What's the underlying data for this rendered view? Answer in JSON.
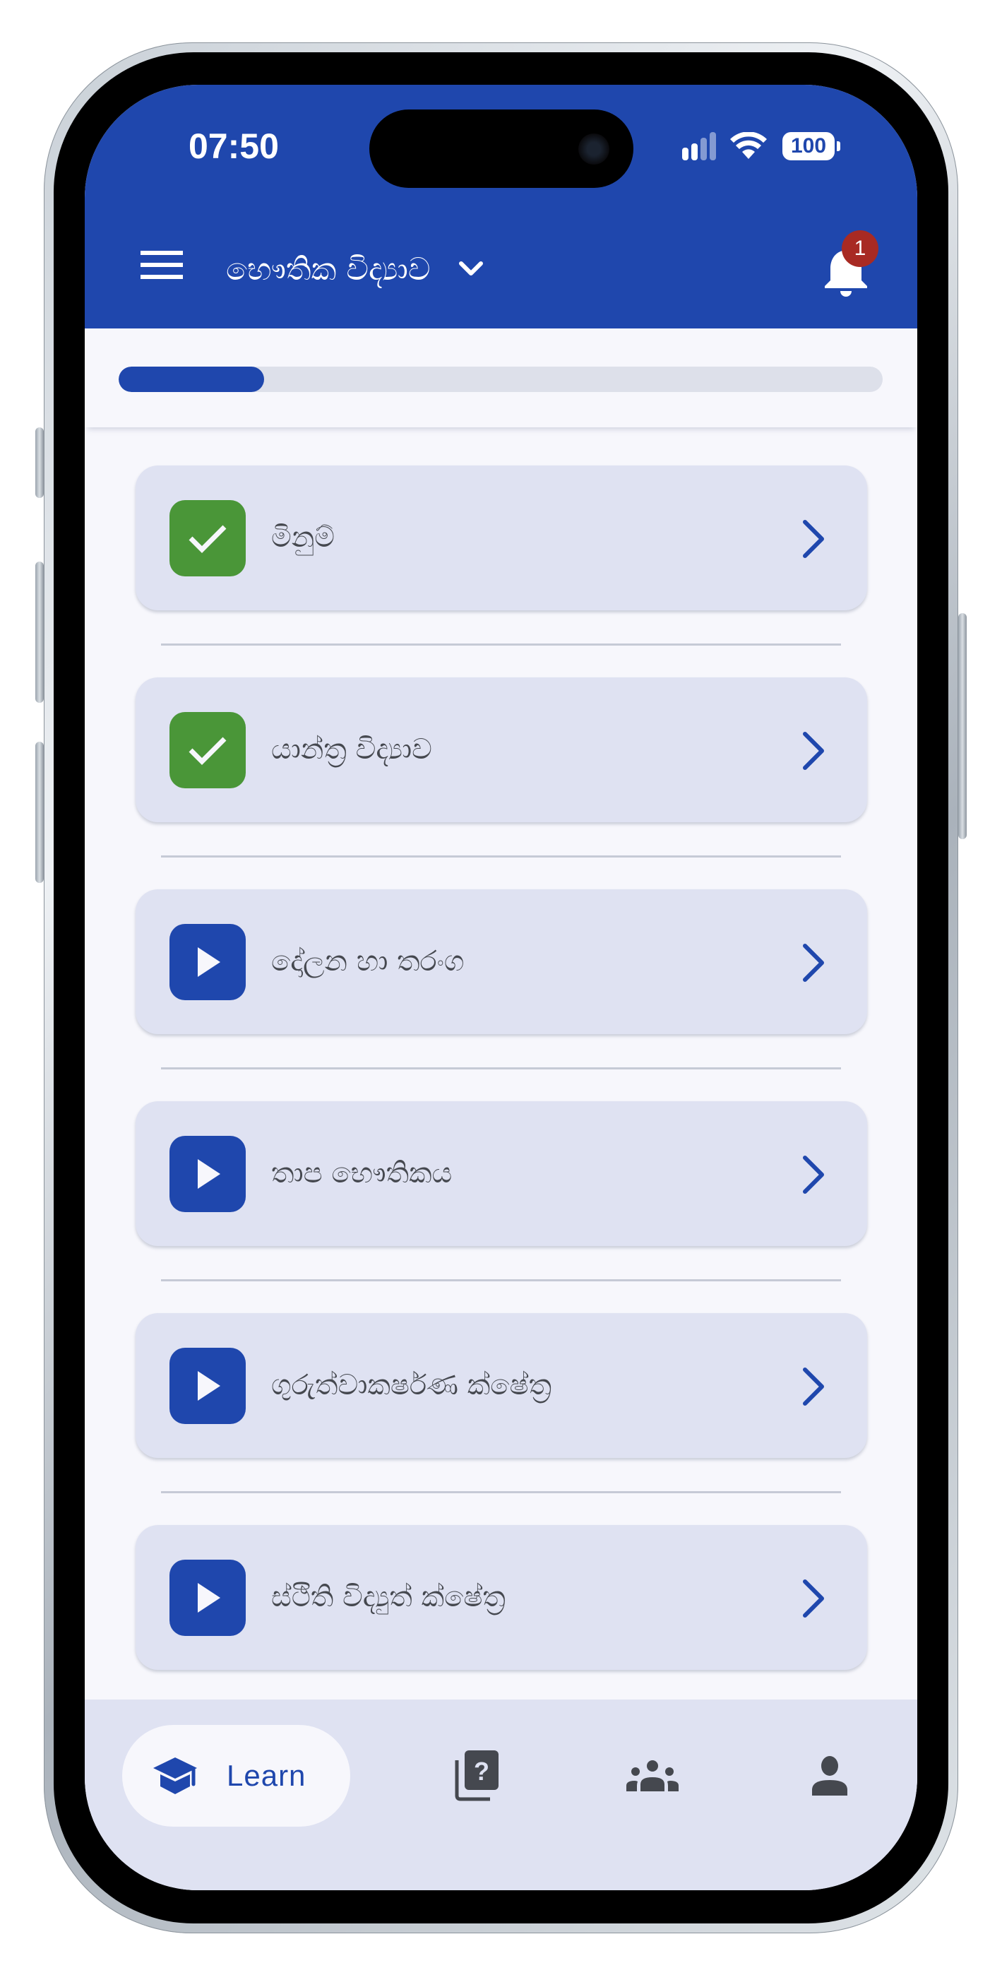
{
  "status_bar": {
    "time": "07:50",
    "signal_bars_active": 2,
    "signal_bars_total": 4,
    "battery_level": "100"
  },
  "header": {
    "menu_icon": "hamburger-menu-icon",
    "subject_title": "භෞතික විද්‍යාව",
    "dropdown_icon": "chevron-down-icon",
    "notification_icon": "bell-icon",
    "notification_count": "1"
  },
  "progress": {
    "fraction_complete": 0.19
  },
  "lessons": [
    {
      "title": "මිනුම්",
      "status": "completed",
      "status_icon": "check-icon",
      "action_icon": "chevron-right-icon"
    },
    {
      "title": "යාන්ත්‍ර විද්‍යාව",
      "status": "completed",
      "status_icon": "check-icon",
      "action_icon": "chevron-right-icon"
    },
    {
      "title": "දෝලන හා තරංග",
      "status": "not-started",
      "status_icon": "play-icon",
      "action_icon": "chevron-right-icon"
    },
    {
      "title": "තාප භෞතිකය",
      "status": "not-started",
      "status_icon": "play-icon",
      "action_icon": "chevron-right-icon"
    },
    {
      "title": "ගුරුත්වාකර්ෂණ ක්ෂේත්‍ර",
      "status": "not-started",
      "status_icon": "play-icon",
      "action_icon": "chevron-right-icon"
    },
    {
      "title": "ස්ථිති විද්‍යුත් ක්ෂේත්‍ර",
      "status": "not-started",
      "status_icon": "play-icon",
      "action_icon": "chevron-right-icon"
    }
  ],
  "bottom_nav": {
    "items": [
      {
        "label": "Learn",
        "icon": "graduation-cap-icon",
        "active": true
      },
      {
        "label": "",
        "icon": "quiz-icon",
        "active": false
      },
      {
        "label": "",
        "icon": "group-icon",
        "active": false
      },
      {
        "label": "",
        "icon": "person-icon",
        "active": false
      }
    ]
  },
  "colors": {
    "primary": "#1f47ad",
    "completed": "#4a9638",
    "badge": "#a82a23",
    "card_background": "#dfe2f2",
    "page_background": "#f7f7fc",
    "icon_muted": "#45484f"
  }
}
